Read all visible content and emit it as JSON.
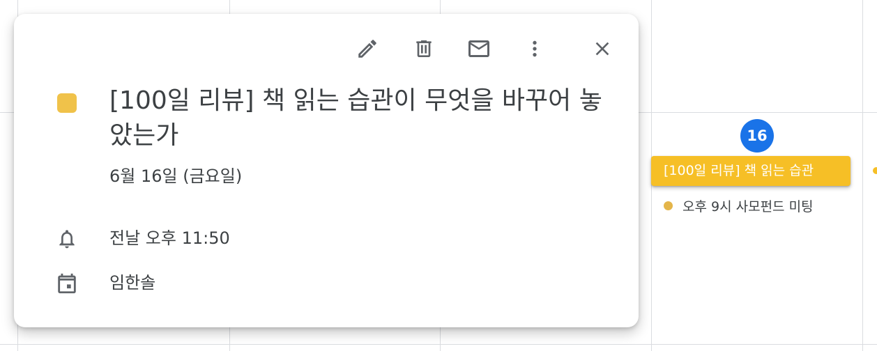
{
  "calendar": {
    "day_badge": "16",
    "events": [
      {
        "label": "[100일 리뷰] 책 읽는 습관",
        "color": "#f6bf26"
      },
      {
        "label": "오후 9시 사모펀드 미팅",
        "color": "#e4b54a"
      }
    ]
  },
  "popup": {
    "toolbar": {
      "edit_icon": "pencil-icon",
      "delete_icon": "trash-icon",
      "email_icon": "mail-icon",
      "more_icon": "more-vert-icon",
      "close_icon": "close-icon"
    },
    "event_color": "#f0c24a",
    "title": "[100일 리뷰] 책 읽는 습관이 무엇을 바꾸어 놓았는가",
    "date": "6월 16일 (금요일)",
    "reminder": "전날 오후 11:50",
    "calendar_owner": "임한솔"
  }
}
